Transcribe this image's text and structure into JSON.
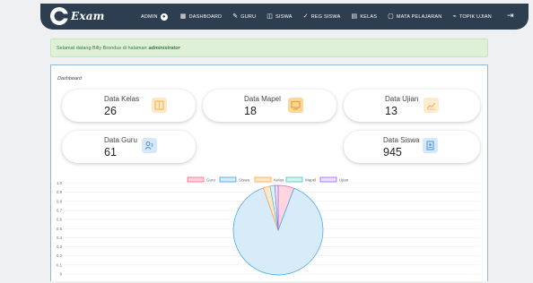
{
  "brand": {
    "name": "Exam"
  },
  "nav": {
    "admin_label": "ADMIN",
    "items": [
      {
        "label": "DASHBOARD",
        "icon": "▦"
      },
      {
        "label": "GURU",
        "icon": "✎"
      },
      {
        "label": "SISWA",
        "icon": "◫"
      },
      {
        "label": "REG SISWA",
        "icon": "✓"
      },
      {
        "label": "KELAS",
        "icon": "▤"
      },
      {
        "label": "MATA PELAJARAN",
        "icon": "▢"
      },
      {
        "label": "TOPIK UJIAN",
        "icon": "⌁"
      }
    ],
    "logout_icon": "⇥"
  },
  "alert": {
    "text": "Selamat datang Billy Brondus di halaman",
    "emph": "administrator"
  },
  "panel": {
    "title": "Dashboard"
  },
  "cards": [
    {
      "label": "Data Kelas",
      "value": "26",
      "icon": "table-icon",
      "color": "#f5c77e",
      "bg": "#fde9c7"
    },
    {
      "label": "Data Mapel",
      "value": "18",
      "icon": "monitor-icon",
      "color": "#f0b85a",
      "bg": "#fde3b5"
    },
    {
      "label": "Data Ujian",
      "value": "13",
      "icon": "line-chart-icon",
      "color": "#f0c27a",
      "bg": "#fdeccf"
    },
    {
      "label": "Data Guru",
      "value": "61",
      "icon": "users-icon",
      "color": "#5aa0e0",
      "bg": "#d6e9fb"
    },
    {
      "label": "Data Siswa",
      "value": "945",
      "icon": "id-badge-icon",
      "color": "#5aa0e0",
      "bg": "#d6e9fb"
    }
  ],
  "chart_data": {
    "type": "pie",
    "categories": [
      "Guru",
      "Siswa",
      "Kelas",
      "Mapel",
      "Ujian"
    ],
    "values": [
      61,
      945,
      26,
      18,
      13
    ],
    "colors": [
      "#ff6384",
      "#36a2eb",
      "#ff9f40",
      "#4bc0c0",
      "#9966ff"
    ],
    "fills": [
      "#ffd6df",
      "#d7ebf9",
      "#ffe8cf",
      "#dbf2f2",
      "#ebe0ff"
    ],
    "y_ticks": [
      "1.0",
      "0.9",
      "0.8",
      "0.7",
      "0.6",
      "0.5",
      "0.4",
      "0.3",
      "0.2",
      "0.1",
      "0"
    ],
    "ylim": [
      0,
      1.0
    ],
    "grid": true,
    "legend_position": "top"
  }
}
